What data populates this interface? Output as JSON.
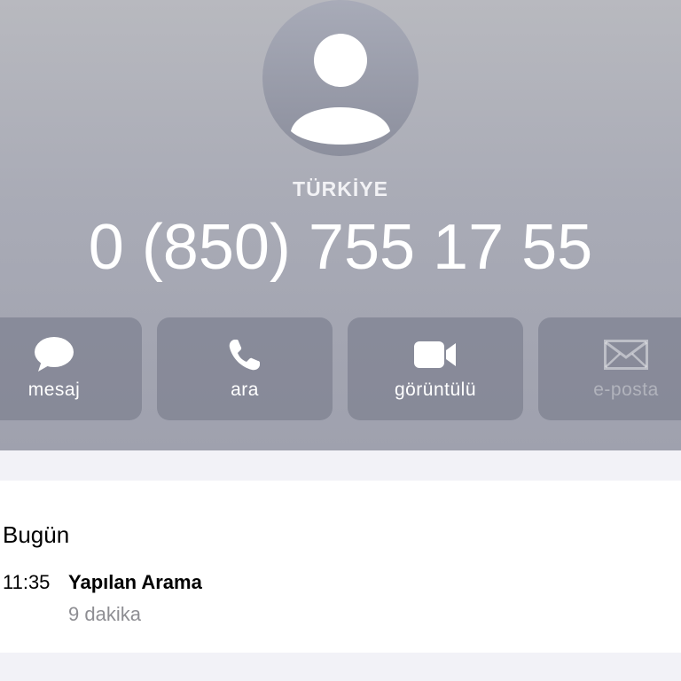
{
  "contact": {
    "country": "TÜRKİYE",
    "phone_number": "0 (850) 755 17 55"
  },
  "actions": [
    {
      "label": "mesaj",
      "icon": "message-bubble-icon",
      "enabled": true
    },
    {
      "label": "ara",
      "icon": "phone-icon",
      "enabled": true
    },
    {
      "label": "görüntülü",
      "icon": "video-camera-icon",
      "enabled": true
    },
    {
      "label": "e-posta",
      "icon": "envelope-icon",
      "enabled": false
    }
  ],
  "history": {
    "section_title": "Bugün",
    "entries": [
      {
        "time": "11:35",
        "type": "Yapılan Arama",
        "duration": "9 dakika"
      }
    ]
  },
  "colors": {
    "header_top": "#b8b9bf",
    "header_bottom": "#9fa1ae",
    "action_button": "#7f8190",
    "secondary_text": "#8e8e93"
  }
}
